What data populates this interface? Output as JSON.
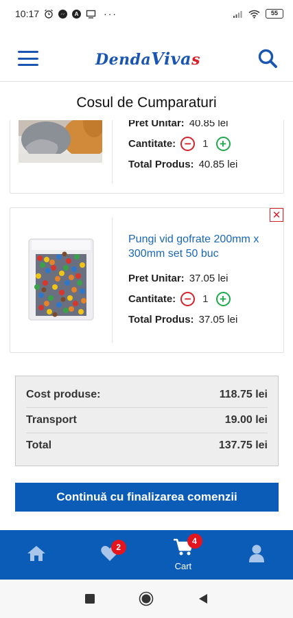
{
  "status_bar": {
    "time": "10:17",
    "more": "···",
    "battery": "55"
  },
  "header": {
    "logo_part1": "Denda",
    "logo_part2": "Viva",
    "logo_part3": "s"
  },
  "page": {
    "title": "Cosul de Cumparaturi"
  },
  "cart": {
    "items": [
      {
        "unit_price_label": "Pret Unitar:",
        "unit_price": "40.85 lei",
        "qty_label": "Cantitate:",
        "quantity": "1",
        "total_label": "Total Produs:",
        "total": "40.85 lei"
      },
      {
        "name": "Pungi vid gofrate 200mm x 300mm set 50 buc",
        "unit_price_label": "Pret Unitar:",
        "unit_price": "37.05 lei",
        "qty_label": "Cantitate:",
        "quantity": "1",
        "total_label": "Total Produs:",
        "total": "37.05 lei"
      }
    ]
  },
  "summary": {
    "products_label": "Cost produse:",
    "products_value": "118.75 lei",
    "transport_label": "Transport",
    "transport_value": "19.00 lei",
    "total_label": "Total",
    "total_value": "137.75 lei"
  },
  "checkout": {
    "label": "Continuă cu finalizarea comenzii"
  },
  "bottom_nav": {
    "favorites_badge": "2",
    "cart_badge": "4",
    "cart_label": "Cart"
  },
  "colors": {
    "brand_blue": "#0b5cb6",
    "link_blue": "#1a66b8",
    "remove_red": "#d6202a",
    "add_green": "#1ea84b"
  }
}
